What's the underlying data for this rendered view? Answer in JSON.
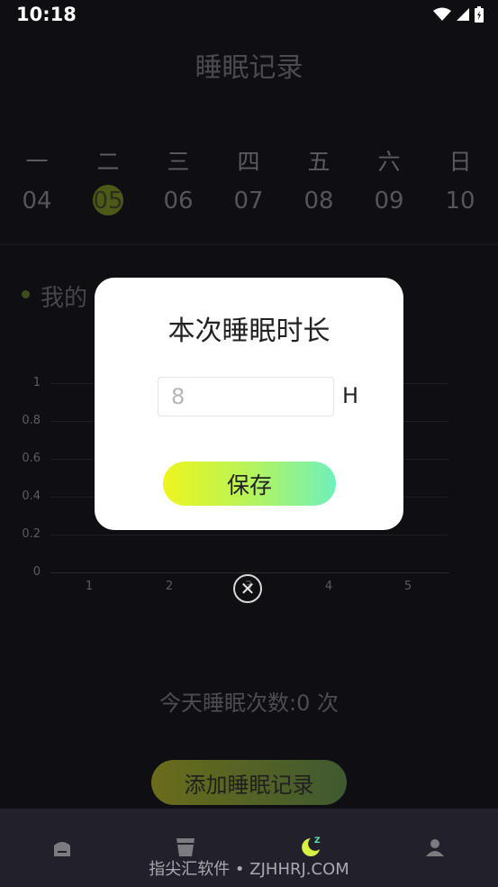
{
  "status_bar": {
    "time": "10:18"
  },
  "page": {
    "title": "睡眠记录"
  },
  "week": [
    {
      "weekday": "一",
      "date": "04"
    },
    {
      "weekday": "二",
      "date": "05"
    },
    {
      "weekday": "三",
      "date": "06"
    },
    {
      "weekday": "四",
      "date": "07"
    },
    {
      "weekday": "五",
      "date": "08"
    },
    {
      "weekday": "六",
      "date": "09"
    },
    {
      "weekday": "日",
      "date": "10"
    }
  ],
  "selected_date": "05",
  "section": {
    "label": "我的"
  },
  "chart_data": {
    "type": "bar",
    "categories": [
      "1",
      "2",
      "3",
      "4",
      "5"
    ],
    "y_ticks": [
      "1",
      "0.8",
      "0.6",
      "0.4",
      "0.2",
      "0"
    ],
    "ylim": [
      0,
      1
    ],
    "grid": true
  },
  "dialog": {
    "title": "本次睡眠时长",
    "input_placeholder": "8",
    "input_value": "",
    "unit": "H",
    "save_label": "保存"
  },
  "close_icon": "close-icon",
  "today_count": "今天睡眠次数:0 次",
  "add_button_label": "添加睡眠记录",
  "tabbar": {
    "icons": [
      "home-icon",
      "cup-icon",
      "sleep-moon-icon",
      "person-icon"
    ],
    "active": "sleep-moon-icon"
  },
  "watermark": "指尖汇软件 • ZJHHRJ.COM",
  "colors": {
    "accent_start": "#eef51f",
    "accent_end": "#6ef0bc",
    "background": "#0e0e13",
    "dialog": "#ffffff"
  }
}
